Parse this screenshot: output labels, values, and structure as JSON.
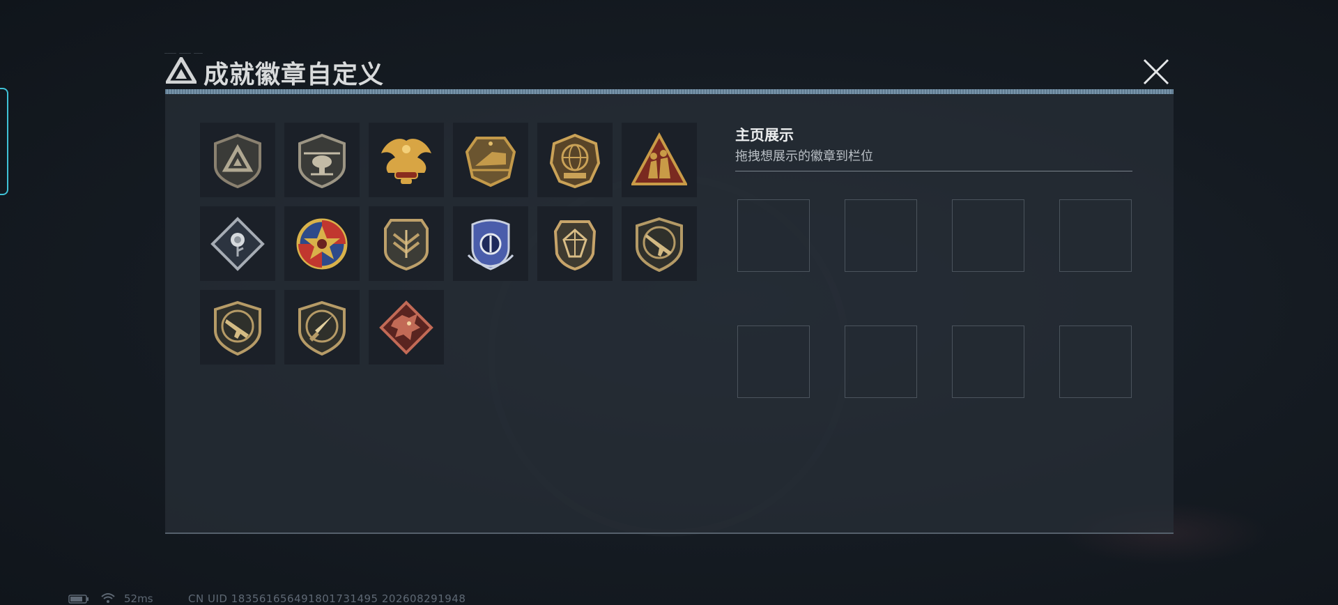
{
  "window": {
    "title": "成就徽章自定义",
    "header_tiny_text": "———— ———— ———"
  },
  "badges": [
    {
      "name": "delta-logo-shield-badge",
      "colors": [
        "#8a8170",
        "#3a3b38"
      ]
    },
    {
      "name": "helicopter-shield-badge",
      "colors": [
        "#9c9584",
        "#3a3b38"
      ]
    },
    {
      "name": "golden-phoenix-badge",
      "colors": [
        "#d8a544",
        "#8a2c1e"
      ]
    },
    {
      "name": "train-medal-badge",
      "colors": [
        "#c49a4a",
        "#6b5530"
      ]
    },
    {
      "name": "deltaforce-2026-globe-badge",
      "colors": [
        "#caa257",
        "#584428"
      ]
    },
    {
      "name": "soldiers-triangle-badge",
      "colors": [
        "#c99b47",
        "#7a2a20"
      ]
    },
    {
      "name": "rose-diamond-badge",
      "colors": [
        "#a6acb4",
        "#2c3440"
      ]
    },
    {
      "name": "star-wheel-badge",
      "colors": [
        "#d9b24a",
        "#c1372f"
      ]
    },
    {
      "name": "chevron-wings-shield-badge",
      "colors": [
        "#bda06a",
        "#3c3c36"
      ]
    },
    {
      "name": "blue-police-shield-badge",
      "colors": [
        "#4a5dab",
        "#1e2a5c"
      ]
    },
    {
      "name": "gem-shield-badge",
      "colors": [
        "#c7a46a",
        "#3e3a30"
      ]
    },
    {
      "name": "rifle-shield-badge",
      "colors": [
        "#b49a66",
        "#2f302b"
      ]
    },
    {
      "name": "smg-shield-badge",
      "colors": [
        "#b69b67",
        "#2f302b"
      ]
    },
    {
      "name": "knife-shield-badge",
      "colors": [
        "#b69b67",
        "#2f302b"
      ]
    },
    {
      "name": "red-dragon-badge",
      "colors": [
        "#c26a56",
        "#5a2420"
      ]
    }
  ],
  "showcase": {
    "title": "主页展示",
    "subtitle": "拖拽想展示的徽章到栏位",
    "slot_count": 8
  },
  "status_bar": {
    "ping": "52ms",
    "uid": "CN UID 183561656491801731495 202608291948"
  },
  "colors": {
    "accent_cyan": "#3fc2d6",
    "gold": "#c9a14e",
    "panel_bg": "#282f38"
  }
}
